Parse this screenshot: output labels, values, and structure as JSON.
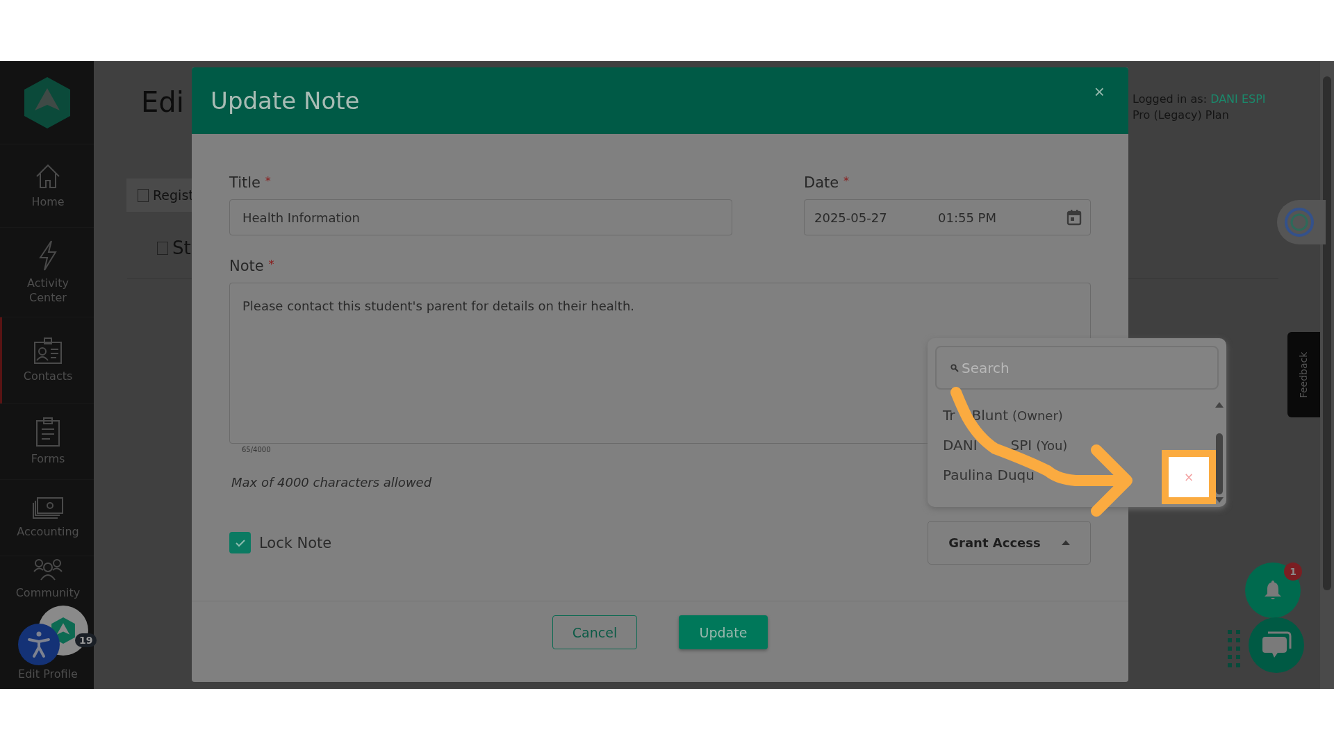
{
  "sidebar": {
    "items": [
      {
        "label": "Home",
        "selected": false
      },
      {
        "label": "Activity Center",
        "selected": false
      },
      {
        "label": "Contacts",
        "selected": true
      },
      {
        "label": "Forms",
        "selected": false
      },
      {
        "label": "Accounting",
        "selected": false
      },
      {
        "label": "Community",
        "selected": false
      },
      {
        "label": "Edit Profile",
        "selected": false
      }
    ],
    "profile_badge": "19"
  },
  "page": {
    "heading": "Edi",
    "tabs": [
      {
        "label": "Regist",
        "selected": true
      },
      {
        "label": "St",
        "selected": false
      }
    ],
    "logged_in_label": "Logged in as:",
    "user": "DANI ESPI",
    "plan": "Pro (Legacy) Plan",
    "feedback": "Feedback",
    "bell_count": "1"
  },
  "modal": {
    "title": "Update Note",
    "close": "×",
    "title_field": {
      "label": "Title",
      "required": "*",
      "value": "Health Information"
    },
    "date_field": {
      "label": "Date",
      "required": "*",
      "date": "2025-05-27",
      "time": "01:55 PM"
    },
    "note_field": {
      "label": "Note",
      "required": "*",
      "value": "Please contact this student's parent for details on their health.",
      "counter": "65/4000"
    },
    "hint": "Max of 4000 characters allowed",
    "lock_note": {
      "label": "Lock Note",
      "checked": true
    },
    "grant_access": {
      "label": "Grant Access",
      "expanded": true
    },
    "buttons": [
      {
        "label": "Cancel",
        "kind": "secondary"
      },
      {
        "label": "Update",
        "kind": "primary"
      }
    ]
  },
  "grant_menu": {
    "search_placeholder": "Search",
    "items": [
      {
        "name_parts": [
          "Tr",
          "Blunt"
        ],
        "role": "(Owner)"
      },
      {
        "name_parts": [
          "DANI",
          "SPI"
        ],
        "role": "(You)"
      },
      {
        "name_parts": [
          "Paulina Duqu"
        ]
      }
    ],
    "highlighted_close": "×"
  }
}
